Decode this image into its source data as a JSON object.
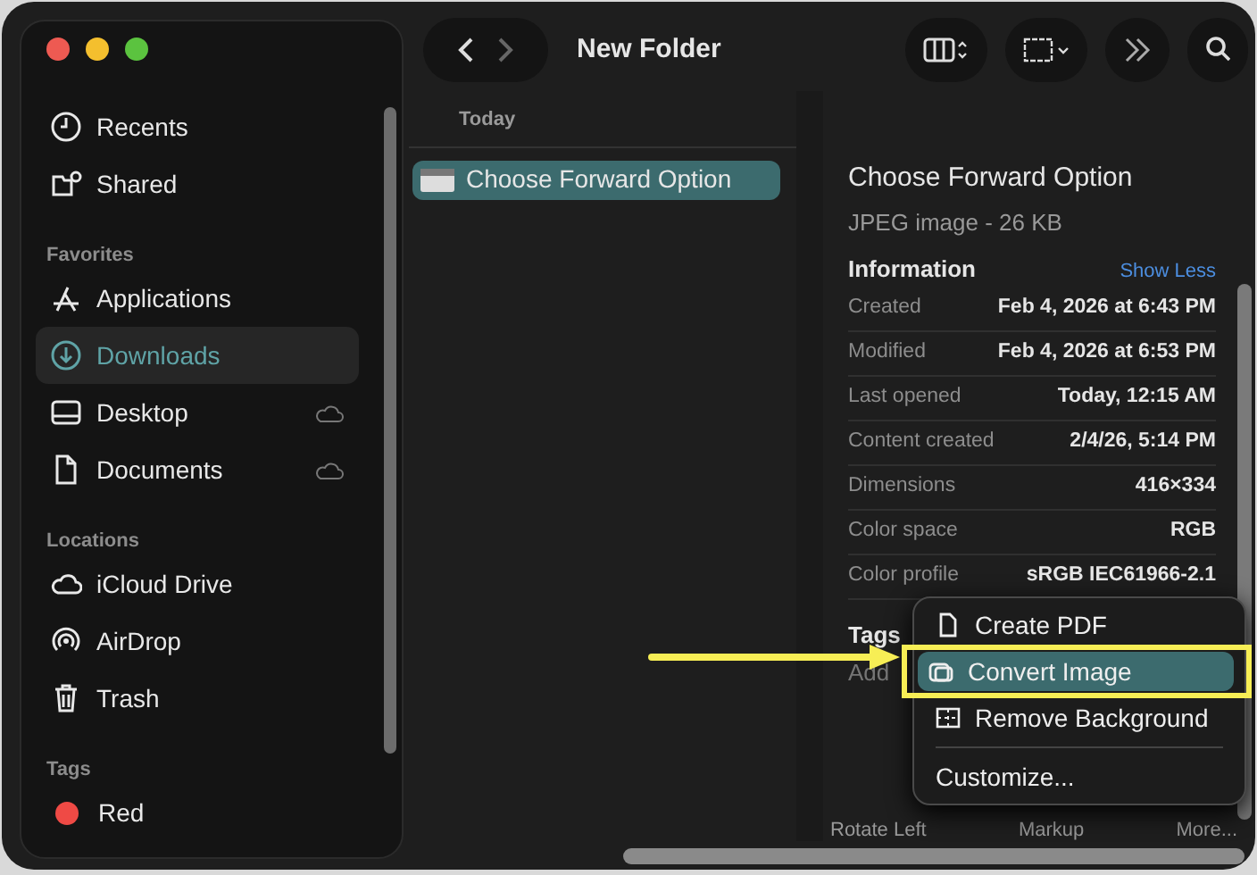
{
  "window": {
    "title": "New Folder"
  },
  "sidebar": {
    "sections": [
      {
        "items": [
          {
            "label": "Recents",
            "selected": false,
            "cloud": false
          },
          {
            "label": "Shared",
            "selected": false,
            "cloud": false
          }
        ]
      },
      {
        "heading": "Favorites",
        "items": [
          {
            "label": "Applications",
            "selected": false,
            "cloud": false
          },
          {
            "label": "Downloads",
            "selected": true,
            "cloud": false
          },
          {
            "label": "Desktop",
            "selected": false,
            "cloud": true
          },
          {
            "label": "Documents",
            "selected": false,
            "cloud": true
          }
        ]
      },
      {
        "heading": "Locations",
        "items": [
          {
            "label": "iCloud Drive",
            "selected": false,
            "cloud": false
          },
          {
            "label": "AirDrop",
            "selected": false,
            "cloud": false
          },
          {
            "label": "Trash",
            "selected": false,
            "cloud": false
          }
        ]
      },
      {
        "heading": "Tags",
        "items": [
          {
            "label": "Red",
            "selected": false,
            "cloud": false,
            "color": "#ef4a45"
          }
        ]
      }
    ]
  },
  "file_list": {
    "group": "Today",
    "files": [
      {
        "name": "Choose Forward Option",
        "selected": true
      }
    ]
  },
  "preview": {
    "name": "Choose Forward Option",
    "subtitle": "JPEG image - 26 KB",
    "section": "Information",
    "toggle": "Show Less",
    "rows": [
      {
        "label": "Created",
        "value": "Feb 4, 2026 at 6:43 PM"
      },
      {
        "label": "Modified",
        "value": "Feb 4, 2026 at 6:53 PM"
      },
      {
        "label": "Last opened",
        "value": "Today, 12:15 AM"
      },
      {
        "label": "Content created",
        "value": "2/4/26, 5:14 PM"
      },
      {
        "label": "Dimensions",
        "value": "416×334"
      },
      {
        "label": "Color space",
        "value": "RGB"
      },
      {
        "label": "Color profile",
        "value": "sRGB IEC61966-2.1"
      }
    ],
    "tags_label": "Tags",
    "tags_placeholder": "Add",
    "actions": [
      "Rotate Left",
      "Markup",
      "More..."
    ]
  },
  "context_menu": {
    "items": [
      {
        "label": "Create PDF",
        "selected": false
      },
      {
        "label": "Convert Image",
        "selected": true
      },
      {
        "label": "Remove Background",
        "selected": false
      }
    ],
    "footer": "Customize..."
  }
}
